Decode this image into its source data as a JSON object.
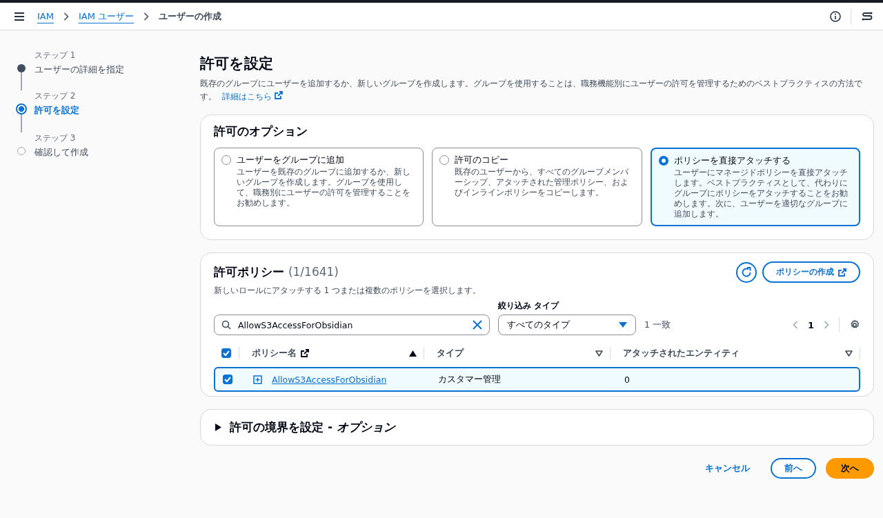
{
  "breadcrumbs": [
    {
      "label": "IAM",
      "link": true
    },
    {
      "label": "IAM ユーザー",
      "link": true
    },
    {
      "label": "ユーザーの作成",
      "link": false
    }
  ],
  "steps": [
    {
      "step": "ステップ 1",
      "label": "ユーザーの詳細を指定",
      "done": true,
      "selected": false
    },
    {
      "step": "ステップ 2",
      "label": "許可を設定",
      "done": false,
      "selected": true
    },
    {
      "step": "ステップ 3",
      "label": "確認して作成",
      "done": false,
      "selected": false
    }
  ],
  "page": {
    "title": "許可を設定",
    "description": "既存のグループにユーザーを追加するか、新しいグループを作成します。グループを使用することは、職務機能別にユーザーの許可を管理するためのベストプラクティスの方法です。",
    "link": "詳細はこちら"
  },
  "options": {
    "title": "許可のオプション",
    "items": [
      {
        "label": "ユーザーをグループに追加",
        "description": "ユーザーを既存のグループに追加するか、新しいグループを作成します。グループを使用して、職務別にユーザーの許可を管理することをお勧めします。",
        "selected": false
      },
      {
        "label": "許可のコピー",
        "description": "既存のユーザーから、すべてのグループメンバーシップ、アタッチされた管理ポリシー、およびインラインポリシーをコピーします。",
        "selected": false
      },
      {
        "label": "ポリシーを直接アタッチする",
        "description": "ユーザーにマネージドポリシーを直接アタッチします。ベストプラクティスとして、代わりにグループにポリシーをアタッチすることをお勧めします。次に、ユーザーを適切なグループに追加します。",
        "selected": true
      }
    ]
  },
  "policies": {
    "title": "許可ポリシー",
    "count": "(1/1641)",
    "create_button": "ポリシーの作成",
    "description": "新しいロールにアタッチする 1 つまたは複数のポリシーを選択します。",
    "search": {
      "value": "AllowS3AccessForObsidian"
    },
    "filter_label": "絞り込み タイプ",
    "filter_value": "すべてのタイプ",
    "matches": "1 一致",
    "page": "1",
    "all_checked": true,
    "columns": [
      {
        "label": "ポリシー名",
        "external": true,
        "sorted": true
      },
      {
        "label": "タイプ",
        "external": false,
        "sorted": false
      },
      {
        "label": "アタッチされたエンティティ",
        "external": false,
        "sorted": false
      }
    ],
    "rows": [
      {
        "name": "AllowS3AccessForObsidian",
        "type": "カスタマー管理",
        "entities": "0",
        "checked": true
      }
    ]
  },
  "boundary": {
    "title": "許可の境界を設定 - *オプション*",
    "expanded": false
  },
  "buttons": {
    "cancel": "キャンセル",
    "previous": "前へ",
    "next": "次へ"
  }
}
